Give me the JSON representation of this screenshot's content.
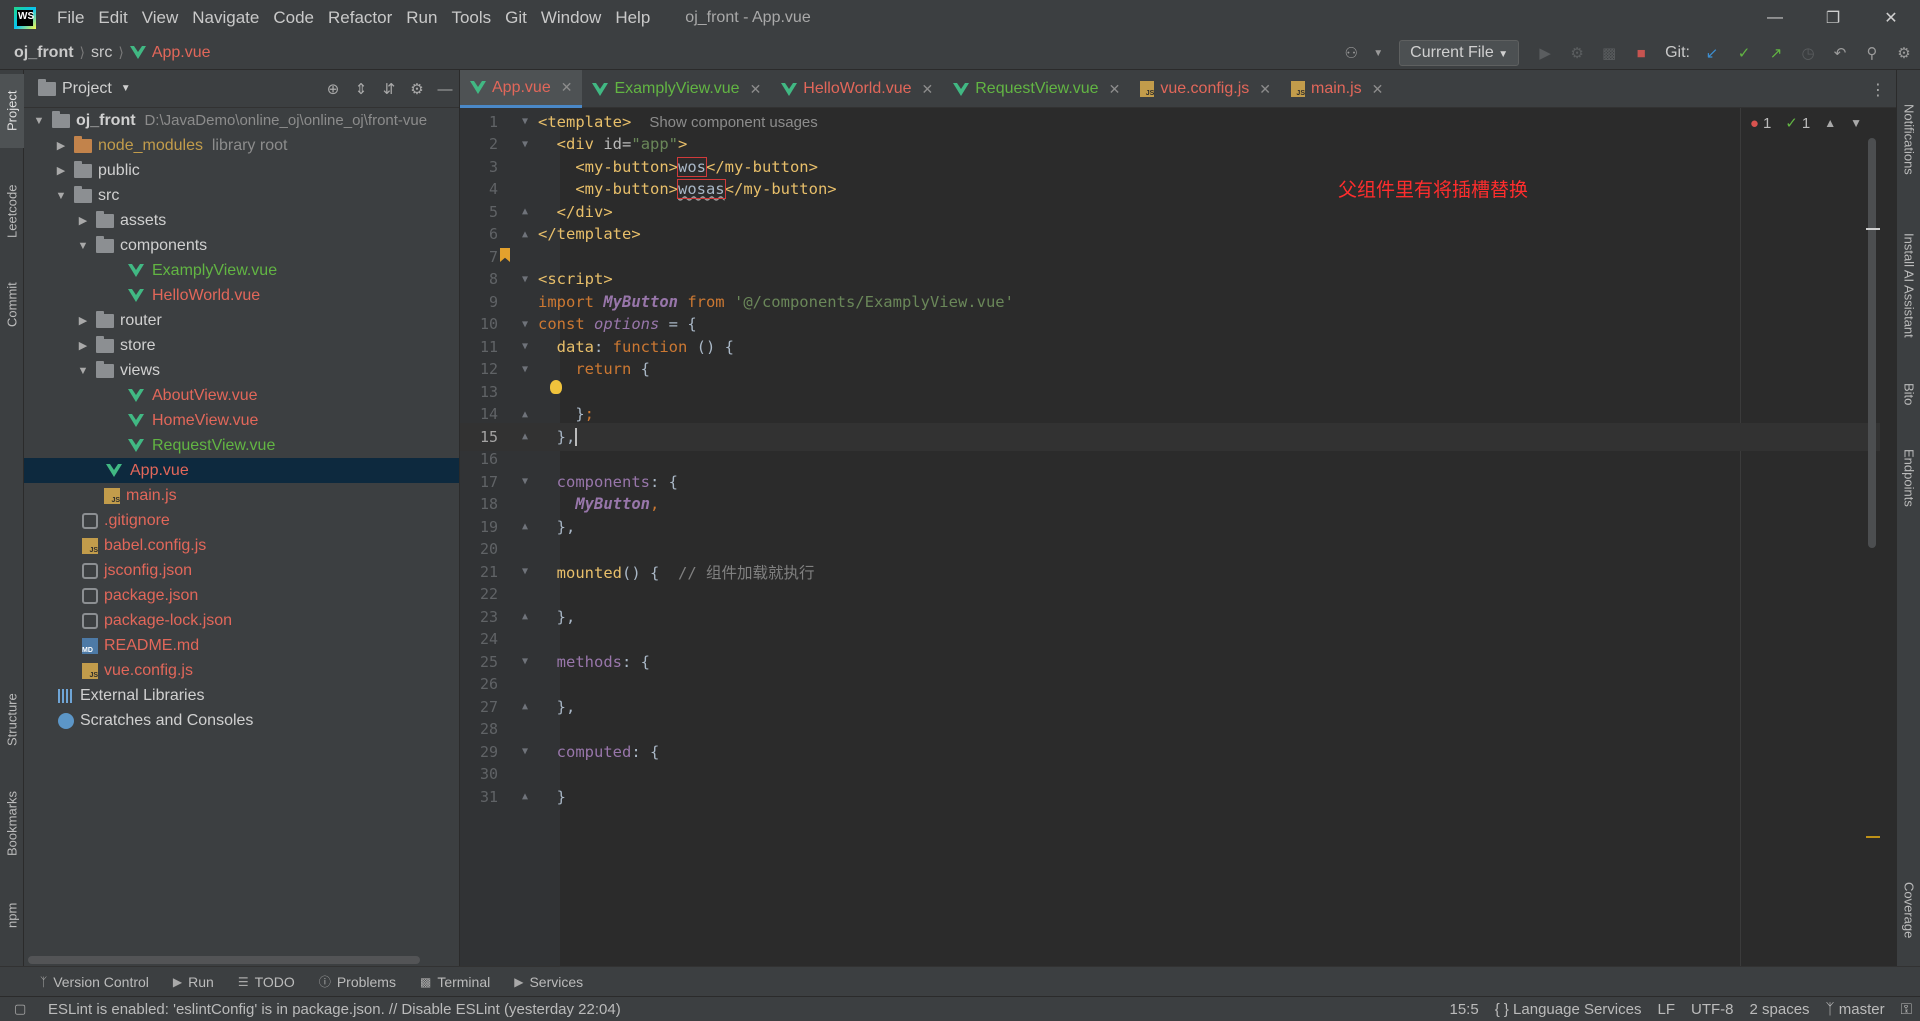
{
  "titlebar": {
    "menu": [
      "File",
      "Edit",
      "View",
      "Navigate",
      "Code",
      "Refactor",
      "Run",
      "Tools",
      "Git",
      "Window",
      "Help"
    ],
    "window_title": "oj_front - App.vue",
    "logo_text": "WS"
  },
  "navbar": {
    "project": "oj_front",
    "folder": "src",
    "file": "App.vue",
    "run_config": "Current File",
    "git_label": "Git:"
  },
  "left_strip": [
    "Project",
    "Leetcode",
    "Commit",
    "Structure",
    "Bookmarks",
    "npm"
  ],
  "right_strip": [
    "Notifications",
    "Install AI Assistant",
    "Bito",
    "Endpoints",
    "Coverage"
  ],
  "project_panel": {
    "title": "Project",
    "root_name": "oj_front",
    "root_path": "D:\\JavaDemo\\online_oj\\online_oj\\front-vue",
    "items": {
      "node_modules": "node_modules",
      "library_root": "library root",
      "public": "public",
      "src": "src",
      "assets": "assets",
      "components": "components",
      "exampl": "ExamplyView.vue",
      "hello": "HelloWorld.vue",
      "router": "router",
      "store": "store",
      "views": "views",
      "about": "AboutView.vue",
      "home": "HomeView.vue",
      "request": "RequestView.vue",
      "app": "App.vue",
      "main": "main.js",
      "gitignore": ".gitignore",
      "babel": "babel.config.js",
      "jsconfig": "jsconfig.json",
      "package": "package.json",
      "packagelock": "package-lock.json",
      "readme": "README.md",
      "vueconfig": "vue.config.js",
      "external": "External Libraries",
      "scratches": "Scratches and Consoles"
    }
  },
  "tabs": [
    "App.vue",
    "ExamplyView.vue",
    "HelloWorld.vue",
    "RequestView.vue",
    "vue.config.js",
    "main.js"
  ],
  "editor": {
    "line_numbers": [
      "1",
      "2",
      "3",
      "4",
      "5",
      "6",
      "7",
      "8",
      "9",
      "10",
      "11",
      "12",
      "13",
      "14",
      "15",
      "16",
      "17",
      "18",
      "19",
      "20",
      "21",
      "22",
      "23",
      "24",
      "25",
      "26",
      "27",
      "28",
      "29",
      "30",
      "31"
    ],
    "hint": "Show component usages",
    "annotation": "父组件里有将插槽替换",
    "inspections": {
      "errors": "1",
      "ok": "1"
    },
    "tokens": {
      "l1": "<template>",
      "l2a": "<div ",
      "l2b": "id",
      "l2c": "=",
      "l2d": "\"app\"",
      "l2e": ">",
      "l3a": "<my-button>",
      "l3b": "wos",
      "l3c": "</my-button>",
      "l4a": "<my-button>",
      "l4b": "wosas",
      "l4c": "</my-button>",
      "l5": "</div>",
      "l6": "</template>",
      "l8": "<script>",
      "l9a": "import ",
      "l9b": "MyButton",
      "l9c": " from ",
      "l9d": "'@/components/ExamplyView.vue'",
      "l10a": "const ",
      "l10b": "options",
      "l10c": " = {",
      "l11a": "data",
      "l11b": ": ",
      "l11c": "function",
      "l11d": " () {",
      "l12a": "return",
      "l12b": " {",
      "l14a": "}",
      "l14b": ";",
      "l15": "},",
      "l17a": "components",
      "l17b": ": {",
      "l18a": "MyButton",
      "l18b": ",",
      "l19": "},",
      "l21a": "mounted",
      "l21b": "() {  ",
      "l21c": "// 组件加载就执行",
      "l23": "},",
      "l25a": "methods",
      "l25b": ": {",
      "l27": "},",
      "l29a": "computed",
      "l29b": ": {",
      "l31": "}"
    }
  },
  "bottom_tools": [
    "Version Control",
    "Run",
    "TODO",
    "Problems",
    "Terminal",
    "Services"
  ],
  "status": {
    "message": "ESLint is enabled: 'eslintConfig' is in package.json. // Disable ESLint (yesterday 22:04)",
    "position": "15:5",
    "language_services": "{ } Language Services",
    "line_sep": "LF",
    "encoding": "UTF-8",
    "indent": "2 spaces",
    "branch": "master"
  }
}
